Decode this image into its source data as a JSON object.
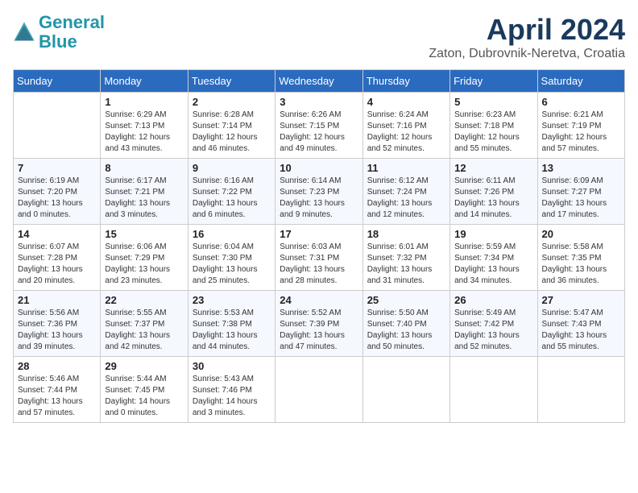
{
  "header": {
    "logo_line1": "General",
    "logo_line2": "Blue",
    "month_title": "April 2024",
    "location": "Zaton, Dubrovnik-Neretva, Croatia"
  },
  "calendar": {
    "days_of_week": [
      "Sunday",
      "Monday",
      "Tuesday",
      "Wednesday",
      "Thursday",
      "Friday",
      "Saturday"
    ],
    "weeks": [
      [
        {
          "day": "",
          "info": ""
        },
        {
          "day": "1",
          "info": "Sunrise: 6:29 AM\nSunset: 7:13 PM\nDaylight: 12 hours\nand 43 minutes."
        },
        {
          "day": "2",
          "info": "Sunrise: 6:28 AM\nSunset: 7:14 PM\nDaylight: 12 hours\nand 46 minutes."
        },
        {
          "day": "3",
          "info": "Sunrise: 6:26 AM\nSunset: 7:15 PM\nDaylight: 12 hours\nand 49 minutes."
        },
        {
          "day": "4",
          "info": "Sunrise: 6:24 AM\nSunset: 7:16 PM\nDaylight: 12 hours\nand 52 minutes."
        },
        {
          "day": "5",
          "info": "Sunrise: 6:23 AM\nSunset: 7:18 PM\nDaylight: 12 hours\nand 55 minutes."
        },
        {
          "day": "6",
          "info": "Sunrise: 6:21 AM\nSunset: 7:19 PM\nDaylight: 12 hours\nand 57 minutes."
        }
      ],
      [
        {
          "day": "7",
          "info": "Sunrise: 6:19 AM\nSunset: 7:20 PM\nDaylight: 13 hours\nand 0 minutes."
        },
        {
          "day": "8",
          "info": "Sunrise: 6:17 AM\nSunset: 7:21 PM\nDaylight: 13 hours\nand 3 minutes."
        },
        {
          "day": "9",
          "info": "Sunrise: 6:16 AM\nSunset: 7:22 PM\nDaylight: 13 hours\nand 6 minutes."
        },
        {
          "day": "10",
          "info": "Sunrise: 6:14 AM\nSunset: 7:23 PM\nDaylight: 13 hours\nand 9 minutes."
        },
        {
          "day": "11",
          "info": "Sunrise: 6:12 AM\nSunset: 7:24 PM\nDaylight: 13 hours\nand 12 minutes."
        },
        {
          "day": "12",
          "info": "Sunrise: 6:11 AM\nSunset: 7:26 PM\nDaylight: 13 hours\nand 14 minutes."
        },
        {
          "day": "13",
          "info": "Sunrise: 6:09 AM\nSunset: 7:27 PM\nDaylight: 13 hours\nand 17 minutes."
        }
      ],
      [
        {
          "day": "14",
          "info": "Sunrise: 6:07 AM\nSunset: 7:28 PM\nDaylight: 13 hours\nand 20 minutes."
        },
        {
          "day": "15",
          "info": "Sunrise: 6:06 AM\nSunset: 7:29 PM\nDaylight: 13 hours\nand 23 minutes."
        },
        {
          "day": "16",
          "info": "Sunrise: 6:04 AM\nSunset: 7:30 PM\nDaylight: 13 hours\nand 25 minutes."
        },
        {
          "day": "17",
          "info": "Sunrise: 6:03 AM\nSunset: 7:31 PM\nDaylight: 13 hours\nand 28 minutes."
        },
        {
          "day": "18",
          "info": "Sunrise: 6:01 AM\nSunset: 7:32 PM\nDaylight: 13 hours\nand 31 minutes."
        },
        {
          "day": "19",
          "info": "Sunrise: 5:59 AM\nSunset: 7:34 PM\nDaylight: 13 hours\nand 34 minutes."
        },
        {
          "day": "20",
          "info": "Sunrise: 5:58 AM\nSunset: 7:35 PM\nDaylight: 13 hours\nand 36 minutes."
        }
      ],
      [
        {
          "day": "21",
          "info": "Sunrise: 5:56 AM\nSunset: 7:36 PM\nDaylight: 13 hours\nand 39 minutes."
        },
        {
          "day": "22",
          "info": "Sunrise: 5:55 AM\nSunset: 7:37 PM\nDaylight: 13 hours\nand 42 minutes."
        },
        {
          "day": "23",
          "info": "Sunrise: 5:53 AM\nSunset: 7:38 PM\nDaylight: 13 hours\nand 44 minutes."
        },
        {
          "day": "24",
          "info": "Sunrise: 5:52 AM\nSunset: 7:39 PM\nDaylight: 13 hours\nand 47 minutes."
        },
        {
          "day": "25",
          "info": "Sunrise: 5:50 AM\nSunset: 7:40 PM\nDaylight: 13 hours\nand 50 minutes."
        },
        {
          "day": "26",
          "info": "Sunrise: 5:49 AM\nSunset: 7:42 PM\nDaylight: 13 hours\nand 52 minutes."
        },
        {
          "day": "27",
          "info": "Sunrise: 5:47 AM\nSunset: 7:43 PM\nDaylight: 13 hours\nand 55 minutes."
        }
      ],
      [
        {
          "day": "28",
          "info": "Sunrise: 5:46 AM\nSunset: 7:44 PM\nDaylight: 13 hours\nand 57 minutes."
        },
        {
          "day": "29",
          "info": "Sunrise: 5:44 AM\nSunset: 7:45 PM\nDaylight: 14 hours\nand 0 minutes."
        },
        {
          "day": "30",
          "info": "Sunrise: 5:43 AM\nSunset: 7:46 PM\nDaylight: 14 hours\nand 3 minutes."
        },
        {
          "day": "",
          "info": ""
        },
        {
          "day": "",
          "info": ""
        },
        {
          "day": "",
          "info": ""
        },
        {
          "day": "",
          "info": ""
        }
      ]
    ]
  }
}
